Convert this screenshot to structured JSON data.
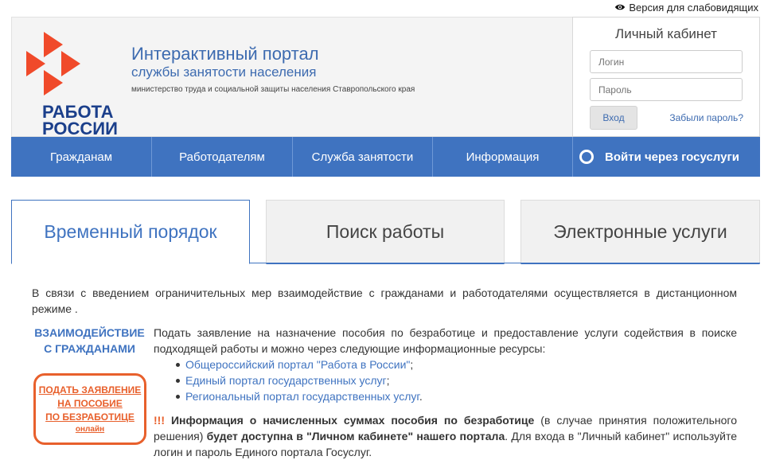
{
  "topbar": {
    "label": "Версия для слабовидящих"
  },
  "header": {
    "brand_line1": "РАБОТА",
    "brand_line2": "РОССИИ",
    "title1": "Интерактивный портал",
    "title2": "службы занятости населения",
    "ministry": "министерство труда и социальной защиты населения Ставропольского края"
  },
  "login": {
    "title": "Личный кабинет",
    "login_placeholder": "Логин",
    "password_placeholder": "Пароль",
    "submit": "Вход",
    "forgot": "Забыли пароль?"
  },
  "nav": {
    "items": [
      "Гражданам",
      "Работодателям",
      "Служба занятости",
      "Информация"
    ],
    "gosuslugi": "Войти через госуслуги"
  },
  "tabs": [
    "Временный порядок",
    "Поиск работы",
    "Электронные услуги"
  ],
  "content": {
    "intro": "В связи с введением ограничительных мер взаимодействие с гражданами и работодателями осуществляется в дистанционном режиме .",
    "left_heading": "ВЗАИМОДЕЙСТВИЕ С ГРАЖДАНАМИ",
    "apply_l1": "ПОДАТЬ ЗАЯВЛЕНИЕ",
    "apply_l2": "НА ПОСОБИЕ",
    "apply_l3": "ПО БЕЗРАБОТИЦЕ",
    "apply_l4": "онлайн",
    "para1": "Подать заявление на назначение пособия по безработице и предоставление услуги содействия в поиске подходящей работы и можно через следующие информационные ресурсы:",
    "links": [
      "Общероссийский портал \"Работа в России\"",
      "Единый портал государственных услуг",
      "Региональный портал государственных услуг"
    ],
    "link_tails": [
      ";",
      ";",
      "."
    ],
    "excl": "!!!",
    "bold1": "Информация о начисленных суммах пособия по безработице",
    "normal1": " (в случае принятия положительного решения) ",
    "bold2": "будет доступна в \"Личном  кабинете\" нашего портала",
    "normal2": ". Для входа в \"Личный кабинет\" используйте логин и пароль Единого портала Госуслуг."
  },
  "colors": {
    "accent": "#3f73c0",
    "orange": "#e8602c",
    "brand": "#1b3f8b"
  }
}
